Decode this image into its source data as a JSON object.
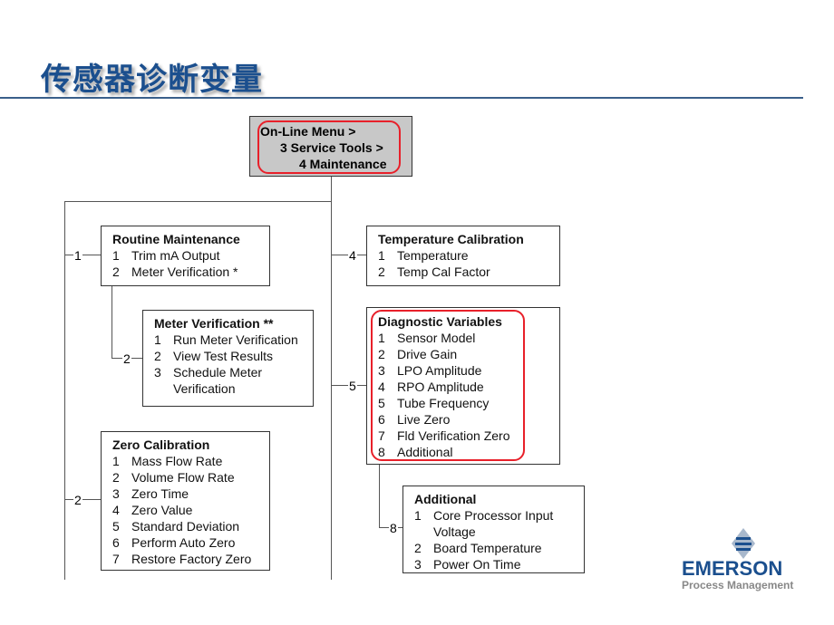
{
  "title": "传感器诊断变量",
  "menu": {
    "lines": [
      "On-Line Menu >",
      "3 Service Tools >",
      "4 Maintenance"
    ]
  },
  "connectors": {
    "routine": "1",
    "zero": "2",
    "meter": "2",
    "temp": "4",
    "diag": "5",
    "additional": "8"
  },
  "boxes": {
    "routine": {
      "title": "Routine Maintenance",
      "items": [
        {
          "n": "1",
          "t": "Trim mA Output"
        },
        {
          "n": "2",
          "t": "Meter Verification *"
        }
      ]
    },
    "meter": {
      "title": "Meter Verification **",
      "items": [
        {
          "n": "1",
          "t": "Run Meter Verification"
        },
        {
          "n": "2",
          "t": "View Test Results"
        },
        {
          "n": "3",
          "t": "Schedule Meter Verification"
        }
      ]
    },
    "zero": {
      "title": "Zero Calibration",
      "items": [
        {
          "n": "1",
          "t": "Mass Flow Rate"
        },
        {
          "n": "2",
          "t": "Volume Flow Rate"
        },
        {
          "n": "3",
          "t": "Zero Time"
        },
        {
          "n": "4",
          "t": "Zero Value"
        },
        {
          "n": "5",
          "t": "Standard Deviation"
        },
        {
          "n": "6",
          "t": "Perform Auto Zero"
        },
        {
          "n": "7",
          "t": "Restore Factory Zero"
        }
      ]
    },
    "temp": {
      "title": "Temperature Calibration",
      "items": [
        {
          "n": "1",
          "t": "Temperature"
        },
        {
          "n": "2",
          "t": "Temp Cal Factor"
        }
      ]
    },
    "diag": {
      "title": "Diagnostic Variables",
      "items": [
        {
          "n": "1",
          "t": "Sensor Model"
        },
        {
          "n": "2",
          "t": "Drive Gain"
        },
        {
          "n": "3",
          "t": "LPO Amplitude"
        },
        {
          "n": "4",
          "t": "RPO Amplitude"
        },
        {
          "n": "5",
          "t": "Tube Frequency"
        },
        {
          "n": "6",
          "t": "Live Zero"
        },
        {
          "n": "7",
          "t": "Fld Verification Zero"
        },
        {
          "n": "8",
          "t": "Additional"
        }
      ]
    },
    "additional": {
      "title": "Additional",
      "items": [
        {
          "n": "1",
          "t": "Core Processor Input Voltage"
        },
        {
          "n": "2",
          "t": "Board Temperature"
        },
        {
          "n": "3",
          "t": "Power On Time"
        }
      ]
    }
  },
  "logo": {
    "brand": "EMERSON",
    "tagline": "Process Management"
  },
  "colors": {
    "title": "#1b4f8e",
    "highlight": "#e8202a",
    "menu_bg": "#c8c8c8"
  }
}
